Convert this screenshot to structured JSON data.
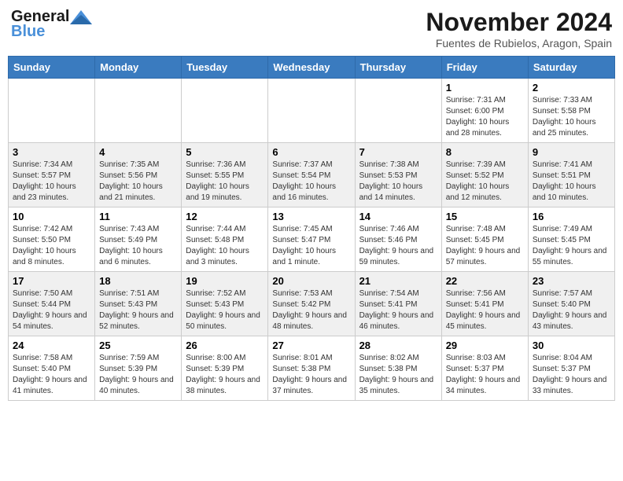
{
  "header": {
    "logo_general": "General",
    "logo_blue": "Blue",
    "month_title": "November 2024",
    "subtitle": "Fuentes de Rubielos, Aragon, Spain"
  },
  "weekdays": [
    "Sunday",
    "Monday",
    "Tuesday",
    "Wednesday",
    "Thursday",
    "Friday",
    "Saturday"
  ],
  "weeks": [
    [
      {
        "day": "",
        "info": ""
      },
      {
        "day": "",
        "info": ""
      },
      {
        "day": "",
        "info": ""
      },
      {
        "day": "",
        "info": ""
      },
      {
        "day": "",
        "info": ""
      },
      {
        "day": "1",
        "info": "Sunrise: 7:31 AM\nSunset: 6:00 PM\nDaylight: 10 hours and 28 minutes."
      },
      {
        "day": "2",
        "info": "Sunrise: 7:33 AM\nSunset: 5:58 PM\nDaylight: 10 hours and 25 minutes."
      }
    ],
    [
      {
        "day": "3",
        "info": "Sunrise: 7:34 AM\nSunset: 5:57 PM\nDaylight: 10 hours and 23 minutes."
      },
      {
        "day": "4",
        "info": "Sunrise: 7:35 AM\nSunset: 5:56 PM\nDaylight: 10 hours and 21 minutes."
      },
      {
        "day": "5",
        "info": "Sunrise: 7:36 AM\nSunset: 5:55 PM\nDaylight: 10 hours and 19 minutes."
      },
      {
        "day": "6",
        "info": "Sunrise: 7:37 AM\nSunset: 5:54 PM\nDaylight: 10 hours and 16 minutes."
      },
      {
        "day": "7",
        "info": "Sunrise: 7:38 AM\nSunset: 5:53 PM\nDaylight: 10 hours and 14 minutes."
      },
      {
        "day": "8",
        "info": "Sunrise: 7:39 AM\nSunset: 5:52 PM\nDaylight: 10 hours and 12 minutes."
      },
      {
        "day": "9",
        "info": "Sunrise: 7:41 AM\nSunset: 5:51 PM\nDaylight: 10 hours and 10 minutes."
      }
    ],
    [
      {
        "day": "10",
        "info": "Sunrise: 7:42 AM\nSunset: 5:50 PM\nDaylight: 10 hours and 8 minutes."
      },
      {
        "day": "11",
        "info": "Sunrise: 7:43 AM\nSunset: 5:49 PM\nDaylight: 10 hours and 6 minutes."
      },
      {
        "day": "12",
        "info": "Sunrise: 7:44 AM\nSunset: 5:48 PM\nDaylight: 10 hours and 3 minutes."
      },
      {
        "day": "13",
        "info": "Sunrise: 7:45 AM\nSunset: 5:47 PM\nDaylight: 10 hours and 1 minute."
      },
      {
        "day": "14",
        "info": "Sunrise: 7:46 AM\nSunset: 5:46 PM\nDaylight: 9 hours and 59 minutes."
      },
      {
        "day": "15",
        "info": "Sunrise: 7:48 AM\nSunset: 5:45 PM\nDaylight: 9 hours and 57 minutes."
      },
      {
        "day": "16",
        "info": "Sunrise: 7:49 AM\nSunset: 5:45 PM\nDaylight: 9 hours and 55 minutes."
      }
    ],
    [
      {
        "day": "17",
        "info": "Sunrise: 7:50 AM\nSunset: 5:44 PM\nDaylight: 9 hours and 54 minutes."
      },
      {
        "day": "18",
        "info": "Sunrise: 7:51 AM\nSunset: 5:43 PM\nDaylight: 9 hours and 52 minutes."
      },
      {
        "day": "19",
        "info": "Sunrise: 7:52 AM\nSunset: 5:43 PM\nDaylight: 9 hours and 50 minutes."
      },
      {
        "day": "20",
        "info": "Sunrise: 7:53 AM\nSunset: 5:42 PM\nDaylight: 9 hours and 48 minutes."
      },
      {
        "day": "21",
        "info": "Sunrise: 7:54 AM\nSunset: 5:41 PM\nDaylight: 9 hours and 46 minutes."
      },
      {
        "day": "22",
        "info": "Sunrise: 7:56 AM\nSunset: 5:41 PM\nDaylight: 9 hours and 45 minutes."
      },
      {
        "day": "23",
        "info": "Sunrise: 7:57 AM\nSunset: 5:40 PM\nDaylight: 9 hours and 43 minutes."
      }
    ],
    [
      {
        "day": "24",
        "info": "Sunrise: 7:58 AM\nSunset: 5:40 PM\nDaylight: 9 hours and 41 minutes."
      },
      {
        "day": "25",
        "info": "Sunrise: 7:59 AM\nSunset: 5:39 PM\nDaylight: 9 hours and 40 minutes."
      },
      {
        "day": "26",
        "info": "Sunrise: 8:00 AM\nSunset: 5:39 PM\nDaylight: 9 hours and 38 minutes."
      },
      {
        "day": "27",
        "info": "Sunrise: 8:01 AM\nSunset: 5:38 PM\nDaylight: 9 hours and 37 minutes."
      },
      {
        "day": "28",
        "info": "Sunrise: 8:02 AM\nSunset: 5:38 PM\nDaylight: 9 hours and 35 minutes."
      },
      {
        "day": "29",
        "info": "Sunrise: 8:03 AM\nSunset: 5:37 PM\nDaylight: 9 hours and 34 minutes."
      },
      {
        "day": "30",
        "info": "Sunrise: 8:04 AM\nSunset: 5:37 PM\nDaylight: 9 hours and 33 minutes."
      }
    ]
  ]
}
